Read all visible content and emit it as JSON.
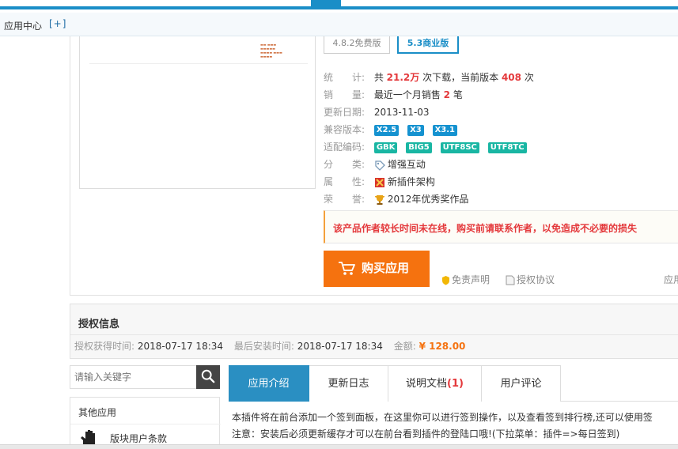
{
  "app_bar": {
    "title": "应用中心",
    "plus": "[+]"
  },
  "versions": {
    "old": "4.8.2免费版",
    "new": "5.3商业版"
  },
  "stats": {
    "downloads": {
      "label": "统　　计:",
      "prefix": "共",
      "total": "21.2万",
      "mid": "次下载，当前版本",
      "current": "408",
      "suffix": "次"
    },
    "sales": {
      "label": "销　　量:",
      "prefix": "最近一个月销售",
      "count": "2",
      "suffix": "笔"
    },
    "updated": {
      "label": "更新日期:",
      "value": "2013-11-03"
    },
    "compat": {
      "label": "兼容版本:",
      "items": [
        "X2.5",
        "X3",
        "X3.1"
      ]
    },
    "encoding": {
      "label": "适配编码:",
      "items": [
        "GBK",
        "BIG5",
        "UTF8SC",
        "UTF8TC"
      ]
    },
    "category": {
      "label": "分　　类:",
      "value": "增强互动",
      "icon": "tag-icon"
    },
    "attribute": {
      "label": "属　　性:",
      "value": "新插件架构",
      "icon": "puzzle-icon"
    },
    "honor": {
      "label": "荣　　誉:",
      "value": "2012年优秀奖作品",
      "icon": "trophy-icon"
    }
  },
  "warning": "该产品作者较长时间未在线，购买前请联系作者，以免造成不必要的损失",
  "buy_button": "购买应用",
  "links": {
    "disclaimer": "免责声明",
    "license": "授权协议",
    "app": "应用"
  },
  "auth": {
    "title": "授权信息",
    "acquired_label": "授权获得时间:",
    "acquired_value": "2018-07-17 18:34",
    "installed_label": "最后安装时间:",
    "installed_value": "2018-07-17 18:34",
    "amount_label": "金额:",
    "amount_value": "¥ 128.00"
  },
  "search": {
    "placeholder": "请输入关键字"
  },
  "other_apps": {
    "title": "其他应用",
    "item_label": "版块用户条款"
  },
  "tabs": {
    "intro": "应用介绍",
    "changelog": "更新日志",
    "docs": "说明文档",
    "docs_count": "(1)",
    "reviews": "用户评论"
  },
  "intro": {
    "line1": "本插件将在前台添加一个签到面板，在这里你可以进行签到操作，以及查看签到排行榜,还可以使用签",
    "line2": "注意：安装后必须更新缓存才可以在前台看到插件的登陆口哦!(下拉菜单：插件=>每日签到)"
  },
  "colors": {
    "accent": "#1a8ec7",
    "buy": "#f5720f",
    "warn": "#e4393c",
    "tab_active": "#2a8fc2"
  }
}
